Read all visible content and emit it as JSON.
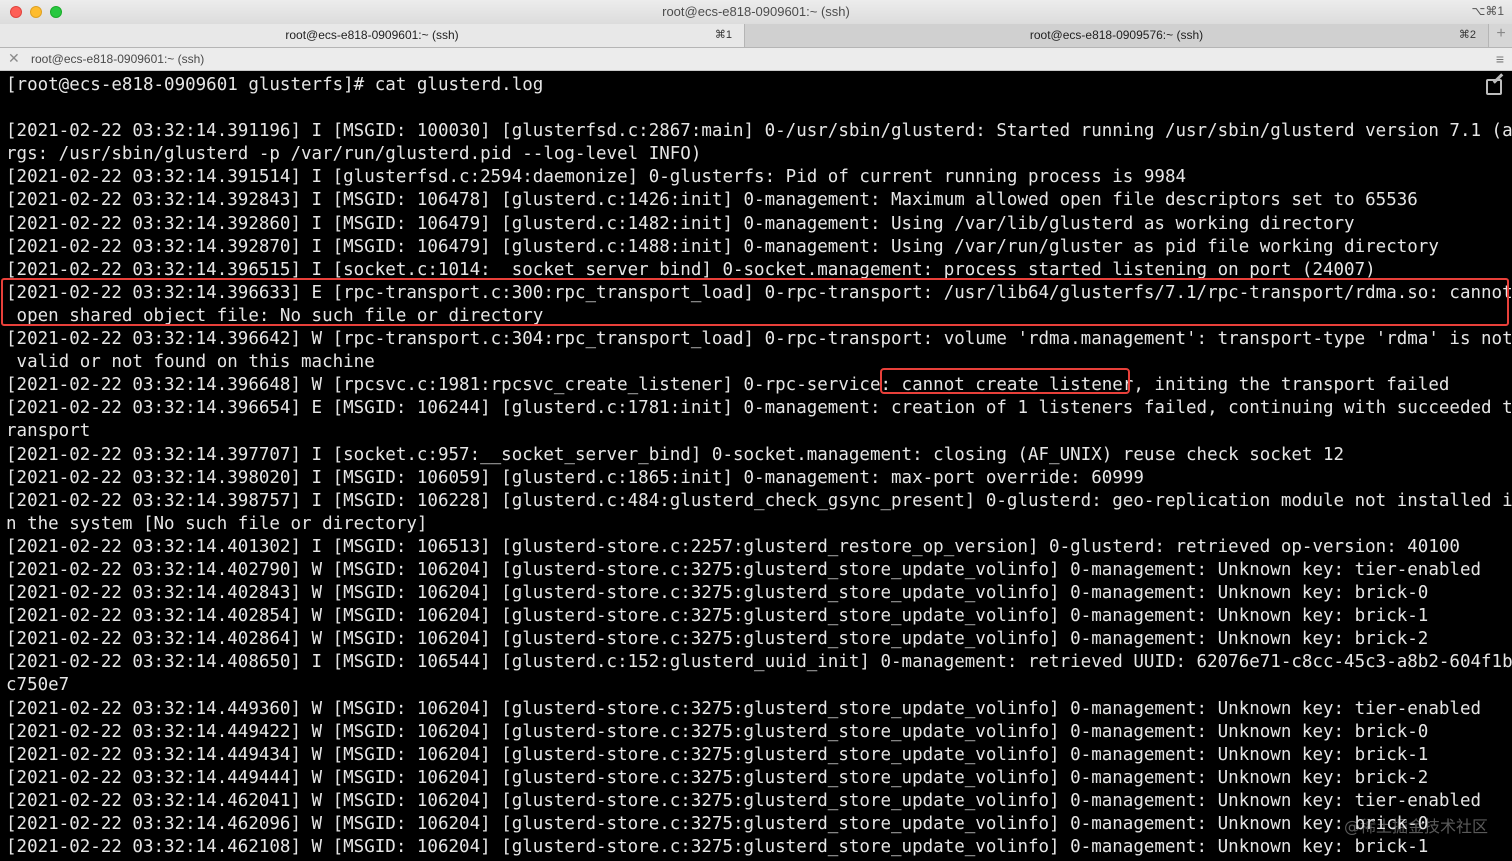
{
  "window": {
    "title": "root@ecs-e818-0909601:~ (ssh)",
    "shortcut": "⌥⌘1"
  },
  "tabs": [
    {
      "label": "root@ecs-e818-0909601:~ (ssh)",
      "key": "⌘1"
    },
    {
      "label": "root@ecs-e818-0909576:~ (ssh)",
      "key": "⌘2"
    }
  ],
  "tab_add": "+",
  "session": {
    "close": "✕",
    "title": "root@ecs-e818-0909601:~ (ssh)",
    "menu": "≡"
  },
  "terminal": {
    "lines": [
      "[root@ecs-e818-0909601 glusterfs]# cat glusterd.log",
      "",
      "[2021-02-22 03:32:14.391196] I [MSGID: 100030] [glusterfsd.c:2867:main] 0-/usr/sbin/glusterd: Started running /usr/sbin/glusterd version 7.1 (a",
      "rgs: /usr/sbin/glusterd -p /var/run/glusterd.pid --log-level INFO)",
      "[2021-02-22 03:32:14.391514] I [glusterfsd.c:2594:daemonize] 0-glusterfs: Pid of current running process is 9984",
      "[2021-02-22 03:32:14.392843] I [MSGID: 106478] [glusterd.c:1426:init] 0-management: Maximum allowed open file descriptors set to 65536",
      "[2021-02-22 03:32:14.392860] I [MSGID: 106479] [glusterd.c:1482:init] 0-management: Using /var/lib/glusterd as working directory",
      "[2021-02-22 03:32:14.392870] I [MSGID: 106479] [glusterd.c:1488:init] 0-management: Using /var/run/gluster as pid file working directory",
      "[2021-02-22 03:32:14.396515] I [socket.c:1014:__socket_server_bind] 0-socket.management: process started listening on port (24007)",
      "[2021-02-22 03:32:14.396633] E [rpc-transport.c:300:rpc_transport_load] 0-rpc-transport: /usr/lib64/glusterfs/7.1/rpc-transport/rdma.so: cannot",
      " open shared object file: No such file or directory",
      "[2021-02-22 03:32:14.396642] W [rpc-transport.c:304:rpc_transport_load] 0-rpc-transport: volume 'rdma.management': transport-type 'rdma' is not",
      " valid or not found on this machine",
      "[2021-02-22 03:32:14.396648] W [rpcsvc.c:1981:rpcsvc_create_listener] 0-rpc-service: cannot create listener, initing the transport failed",
      "[2021-02-22 03:32:14.396654] E [MSGID: 106244] [glusterd.c:1781:init] 0-management: creation of 1 listeners failed, continuing with succeeded t",
      "ransport",
      "[2021-02-22 03:32:14.397707] I [socket.c:957:__socket_server_bind] 0-socket.management: closing (AF_UNIX) reuse check socket 12",
      "[2021-02-22 03:32:14.398020] I [MSGID: 106059] [glusterd.c:1865:init] 0-management: max-port override: 60999",
      "[2021-02-22 03:32:14.398757] I [MSGID: 106228] [glusterd.c:484:glusterd_check_gsync_present] 0-glusterd: geo-replication module not installed i",
      "n the system [No such file or directory]",
      "[2021-02-22 03:32:14.401302] I [MSGID: 106513] [glusterd-store.c:2257:glusterd_restore_op_version] 0-glusterd: retrieved op-version: 40100",
      "[2021-02-22 03:32:14.402790] W [MSGID: 106204] [glusterd-store.c:3275:glusterd_store_update_volinfo] 0-management: Unknown key: tier-enabled",
      "[2021-02-22 03:32:14.402843] W [MSGID: 106204] [glusterd-store.c:3275:glusterd_store_update_volinfo] 0-management: Unknown key: brick-0",
      "[2021-02-22 03:32:14.402854] W [MSGID: 106204] [glusterd-store.c:3275:glusterd_store_update_volinfo] 0-management: Unknown key: brick-1",
      "[2021-02-22 03:32:14.402864] W [MSGID: 106204] [glusterd-store.c:3275:glusterd_store_update_volinfo] 0-management: Unknown key: brick-2",
      "[2021-02-22 03:32:14.408650] I [MSGID: 106544] [glusterd.c:152:glusterd_uuid_init] 0-management: retrieved UUID: 62076e71-c8cc-45c3-a8b2-604f1b",
      "c750e7",
      "[2021-02-22 03:32:14.449360] W [MSGID: 106204] [glusterd-store.c:3275:glusterd_store_update_volinfo] 0-management: Unknown key: tier-enabled",
      "[2021-02-22 03:32:14.449422] W [MSGID: 106204] [glusterd-store.c:3275:glusterd_store_update_volinfo] 0-management: Unknown key: brick-0",
      "[2021-02-22 03:32:14.449434] W [MSGID: 106204] [glusterd-store.c:3275:glusterd_store_update_volinfo] 0-management: Unknown key: brick-1",
      "[2021-02-22 03:32:14.449444] W [MSGID: 106204] [glusterd-store.c:3275:glusterd_store_update_volinfo] 0-management: Unknown key: brick-2",
      "[2021-02-22 03:32:14.462041] W [MSGID: 106204] [glusterd-store.c:3275:glusterd_store_update_volinfo] 0-management: Unknown key: tier-enabled",
      "[2021-02-22 03:32:14.462096] W [MSGID: 106204] [glusterd-store.c:3275:glusterd_store_update_volinfo] 0-management: Unknown key: brick-0",
      "[2021-02-22 03:32:14.462108] W [MSGID: 106204] [glusterd-store.c:3275:glusterd_store_update_volinfo] 0-management: Unknown key: brick-1"
    ]
  },
  "watermark": "@稀土掘金技术社区",
  "colors": {
    "highlight": "#e8403a",
    "terminal_bg": "#000000",
    "terminal_fg": "#e6e6e6"
  }
}
